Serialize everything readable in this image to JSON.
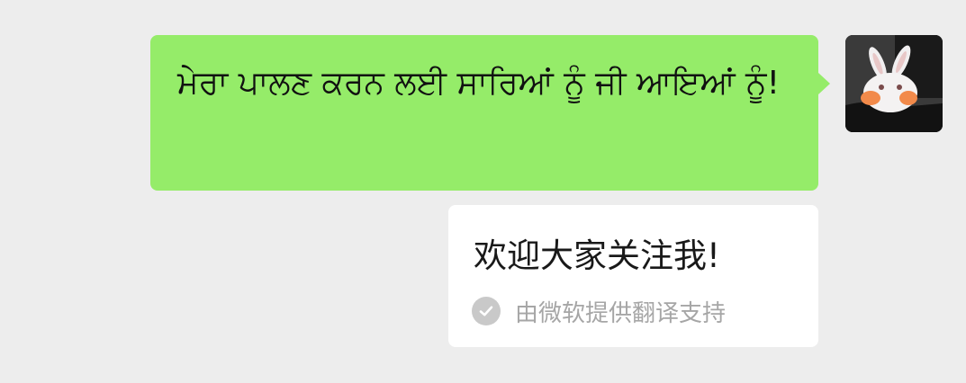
{
  "message": {
    "text": "ਮੇਰਾ ਪਾਲਣ ਕਰਨ ਲਈ ਸਾਰਿਆਂ ਨੂੰ ਜੀ ਆਇਆਂ ਨੂੰ!",
    "bubble_color": "#95ec69"
  },
  "sender": {
    "avatar_icon": "rabbit-avatar"
  },
  "translation": {
    "text": "欢迎大家关注我!",
    "credit": "由微软提供翻译支持",
    "credit_icon": "check-circle-icon"
  },
  "colors": {
    "background": "#ededed",
    "translation_bubble": "#ffffff",
    "muted_text": "#a6a6a6"
  }
}
